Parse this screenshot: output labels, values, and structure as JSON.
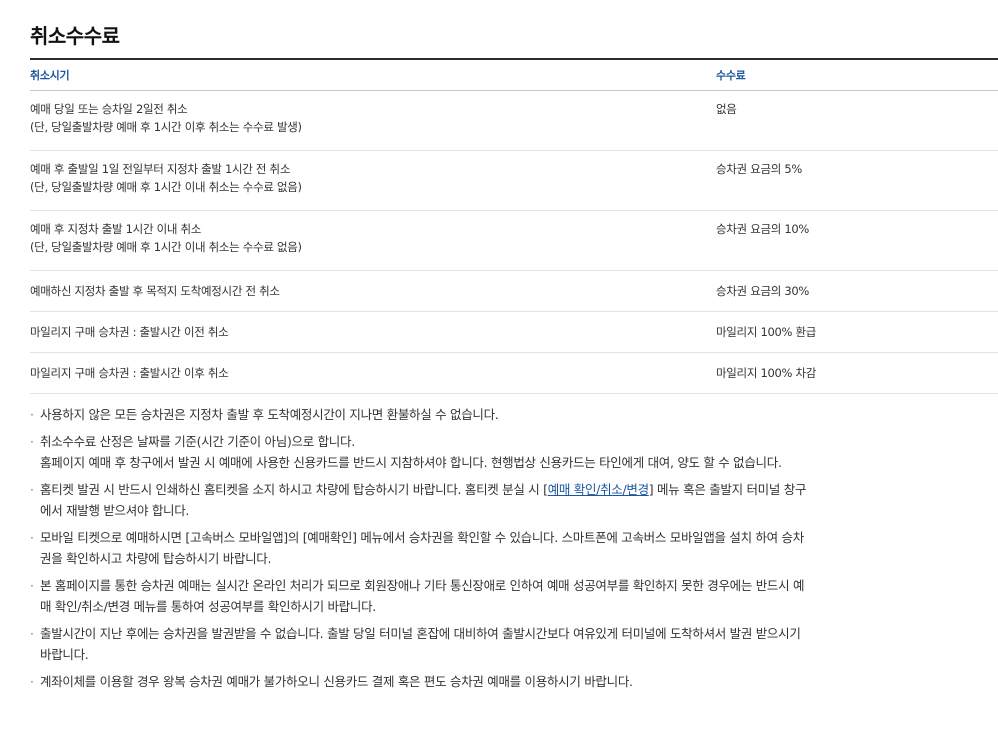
{
  "section_title": "취소수수료",
  "table": {
    "headers": {
      "period": "취소시기",
      "fee": "수수료"
    },
    "rows": [
      {
        "period_line1": "예매 당일 또는 승차일 2일전 취소",
        "period_line2": "(단, 당일출발차량 예매 후 1시간 이후 취소는 수수료 발생)",
        "fee": "없음"
      },
      {
        "period_line1": "예매 후 출발일 1일 전일부터 지정차 출발 1시간 전 취소",
        "period_line2": "(단, 당일출발차량 예매 후 1시간 이내 취소는 수수료 없음)",
        "fee": "승차권 요금의 5%"
      },
      {
        "period_line1": "예매 후 지정차 출발 1시간 이내 취소",
        "period_line2": "(단, 당일출발차량 예매 후 1시간 이내 취소는 수수료 없음)",
        "fee": "승차권 요금의 10%"
      },
      {
        "period_line1": "예매하신 지정차 출발 후 목적지 도착예정시간 전 취소",
        "fee": "승차권 요금의 30%"
      },
      {
        "period_line1": "마일리지 구매 승차권 : 출발시간 이전 취소",
        "fee": "마일리지 100% 환급"
      },
      {
        "period_line1": "마일리지 구매 승차권 : 출발시간 이후 취소",
        "fee": "마일리지 100% 차감"
      }
    ]
  },
  "notes": {
    "bullet": "·",
    "n1": "사용하지 않은 모든 승차권은 지정차 출발 후 도착예정시간이 지나면 환불하실 수 없습니다.",
    "n2_line1": "취소수수료 산정은 날짜를 기준(시간 기준이 아님)으로 합니다.",
    "n2_line2": "홈페이지 예매 후 창구에서 발권 시 예매에 사용한 신용카드를 반드시 지참하셔야 합니다. 현행법상 신용카드는 타인에게 대여, 양도 할 수 없습니다.",
    "n3_before": "홈티켓 발권 시 반드시 인쇄하신 홈티켓을 소지 하시고 차량에 탑승하시기 바랍니다. 홈티켓 분실 시 [",
    "n3_link": "예매 확인/취소/변경",
    "n3_after": "] 메뉴 혹은 출발지 터미널 창구",
    "n3_line2": "에서 재발행 받으셔야 합니다.",
    "n4_line1": "모바일 티켓으로 예매하시면 [고속버스 모바일앱]의 [예매확인] 메뉴에서 승차권을 확인할 수 있습니다. 스마트폰에 고속버스 모바일앱을 설치 하여 승차",
    "n4_line2": "권을 확인하시고 차량에 탑승하시기 바랍니다.",
    "n5_line1": "본 홈페이지를 통한 승차권 예매는 실시간 온라인 처리가 되므로 회원장애나 기타 통신장애로 인하여 예매 성공여부를 확인하지 못한 경우에는 반드시 예",
    "n5_line2": "매 확인/취소/변경 메뉴를 통하여 성공여부를 확인하시기 바랍니다.",
    "n6_line1": "출발시간이 지난 후에는 승차권을 발권받을 수 없습니다. 출발 당일 터미널 혼잡에 대비하여 출발시간보다 여유있게 터미널에 도착하셔서 발권 받으시기",
    "n6_line2": "바랍니다.",
    "n7": "계좌이체를 이용할 경우 왕복 승차권 예매가 불가하오니 신용카드 결제 혹은 편도 승차권 예매를 이용하시기 바랍니다."
  },
  "colors": {
    "header_text": "#1a57a0",
    "link": "#1a57a0",
    "body_text": "#333333"
  }
}
